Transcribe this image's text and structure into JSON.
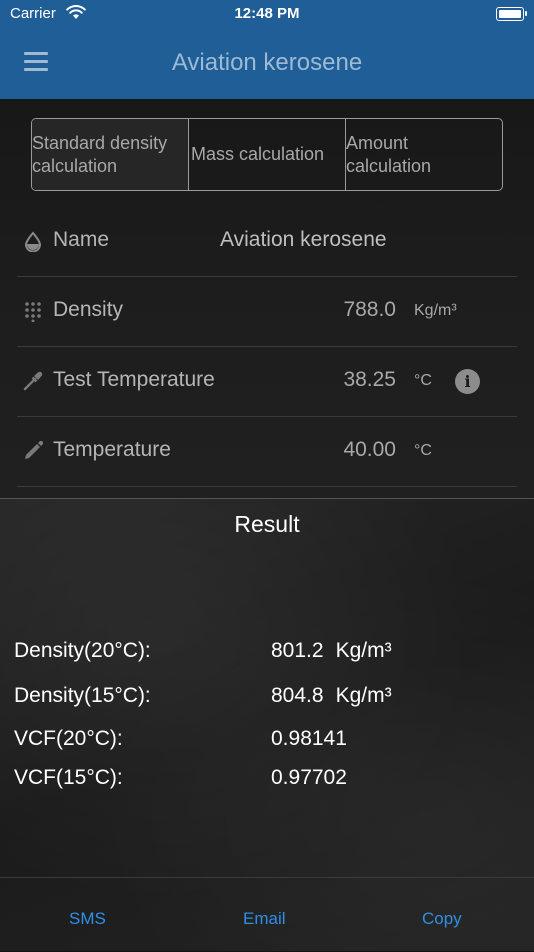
{
  "status_bar": {
    "carrier": "Carrier",
    "time": "12:48 PM"
  },
  "nav": {
    "title": "Aviation kerosene",
    "menu_icon": "hamburger-icon"
  },
  "segments": [
    {
      "line1": "Standard density",
      "line2": "calculation"
    },
    {
      "line1": "Mass calculation",
      "line2": ""
    },
    {
      "line1": "Amount",
      "line2": "calculation"
    }
  ],
  "fields": {
    "name": {
      "label": "Name",
      "value": "Aviation kerosene",
      "icon": "drop-icon"
    },
    "density": {
      "label": "Density",
      "value": "788.0",
      "unit": "Kg/m³",
      "icon": "keypad-icon"
    },
    "test_temperature": {
      "label": "Test Temperature",
      "value": "38.25",
      "unit": "°C",
      "icon": "dropper-icon",
      "info_icon": "info-icon"
    },
    "temperature": {
      "label": "Temperature",
      "value": "40.00",
      "unit": "°C",
      "icon": "pencil-icon"
    }
  },
  "result": {
    "title": "Result",
    "rows": [
      {
        "label": "Density(20°C):",
        "value": "801.2",
        "unit": "Kg/m³"
      },
      {
        "label": "Density(15°C):",
        "value": "804.8",
        "unit": "Kg/m³"
      },
      {
        "label": "VCF(20°C):",
        "value": "0.98141",
        "unit": ""
      },
      {
        "label": "VCF(15°C):",
        "value": "0.97702",
        "unit": ""
      }
    ]
  },
  "actions": {
    "sms": "SMS",
    "email": "Email",
    "copy": "Copy"
  },
  "colors": {
    "nav_bar": "#1f5e96",
    "action_blue": "#2f8ee6"
  }
}
